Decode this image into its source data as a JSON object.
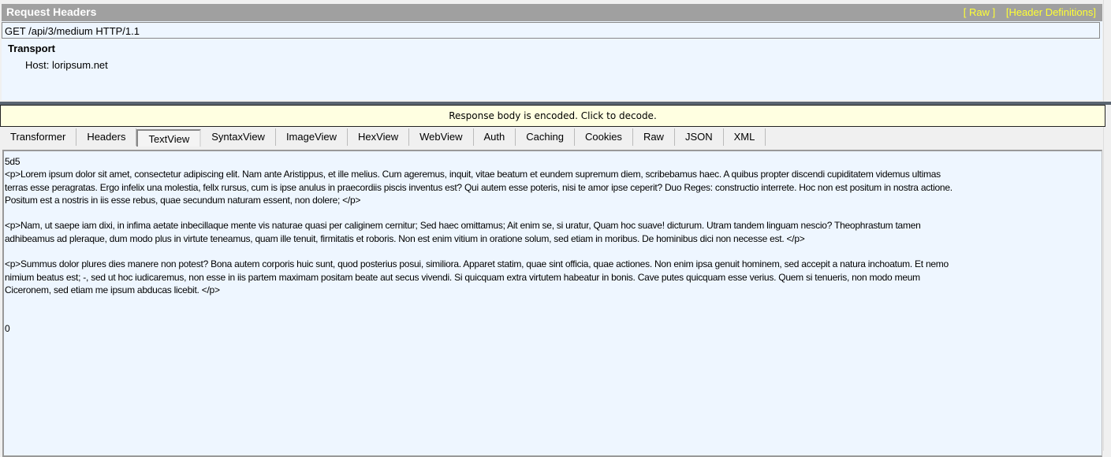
{
  "request_headers": {
    "title": "Request Headers",
    "links": [
      "[ Raw ]",
      "[Header Definitions]"
    ],
    "request_line": "GET /api/3/medium HTTP/1.1",
    "group": "Transport",
    "headers": [
      "Host: loripsum.net"
    ]
  },
  "response": {
    "decode_banner": "Response body is encoded. Click to decode.",
    "tabs": [
      {
        "label": "Transformer"
      },
      {
        "label": "Headers"
      },
      {
        "label": "TextView",
        "active": true
      },
      {
        "label": "SyntaxView"
      },
      {
        "label": "ImageView"
      },
      {
        "label": "HexView"
      },
      {
        "label": "WebView"
      },
      {
        "label": "Auth"
      },
      {
        "label": "Caching"
      },
      {
        "label": "Cookies"
      },
      {
        "label": "Raw"
      },
      {
        "label": "JSON"
      },
      {
        "label": "XML"
      }
    ],
    "body_lines": [
      "5d5",
      "<p>Lorem ipsum dolor sit amet, consectetur adipiscing elit. Nam ante Aristippus, et ille melius. Cum ageremus, inquit, vitae beatum et eundem supremum diem, scribebamus haec. A quibus propter discendi cupiditatem videmus ultimas",
      "terras esse peragratas. Ergo infelix una molestia, fellx rursus, cum is ipse anulus in praecordiis piscis inventus est? Qui autem esse poteris, nisi te amor ipse ceperit? Duo Reges: constructio interrete. Hoc non est positum in nostra actione.",
      "Positum est a nostris in iis esse rebus, quae secundum naturam essent, non dolere; </p>",
      "",
      "<p>Nam, ut saepe iam dixi, in infima aetate inbecillaque mente vis naturae quasi per caliginem cernitur; Sed haec omittamus; Ait enim se, si uratur, Quam hoc suave! dicturum. Utram tandem linguam nescio? Theophrastum tamen",
      "adhibeamus ad pleraque, dum modo plus in virtute teneamus, quam ille tenuit, firmitatis et roboris. Non est enim vitium in oratione solum, sed etiam in moribus. De hominibus dici non necesse est. </p>",
      "",
      "<p>Summus dolor plures dies manere non potest? Bona autem corporis huic sunt, quod posterius posui, similiora. Apparet statim, quae sint officia, quae actiones. Non enim ipsa genuit hominem, sed accepit a natura inchoatum. Et nemo",
      "nimium beatus est; -, sed ut hoc iudicaremus, non esse in iis partem maximam positam beate aut secus vivendi. Si quicquam extra virtutem habeatur in bonis. Cave putes quicquam esse verius. Quem si tenueris, non modo meum",
      "Ciceronem, sed etiam me ipsum abducas licebit. </p>",
      "",
      "",
      "0"
    ]
  },
  "colors": {
    "header_bar": "#a0a0a0",
    "link": "#ffff33",
    "pane_bg": "#eef6ff",
    "banner_bg": "#ffffe1"
  }
}
